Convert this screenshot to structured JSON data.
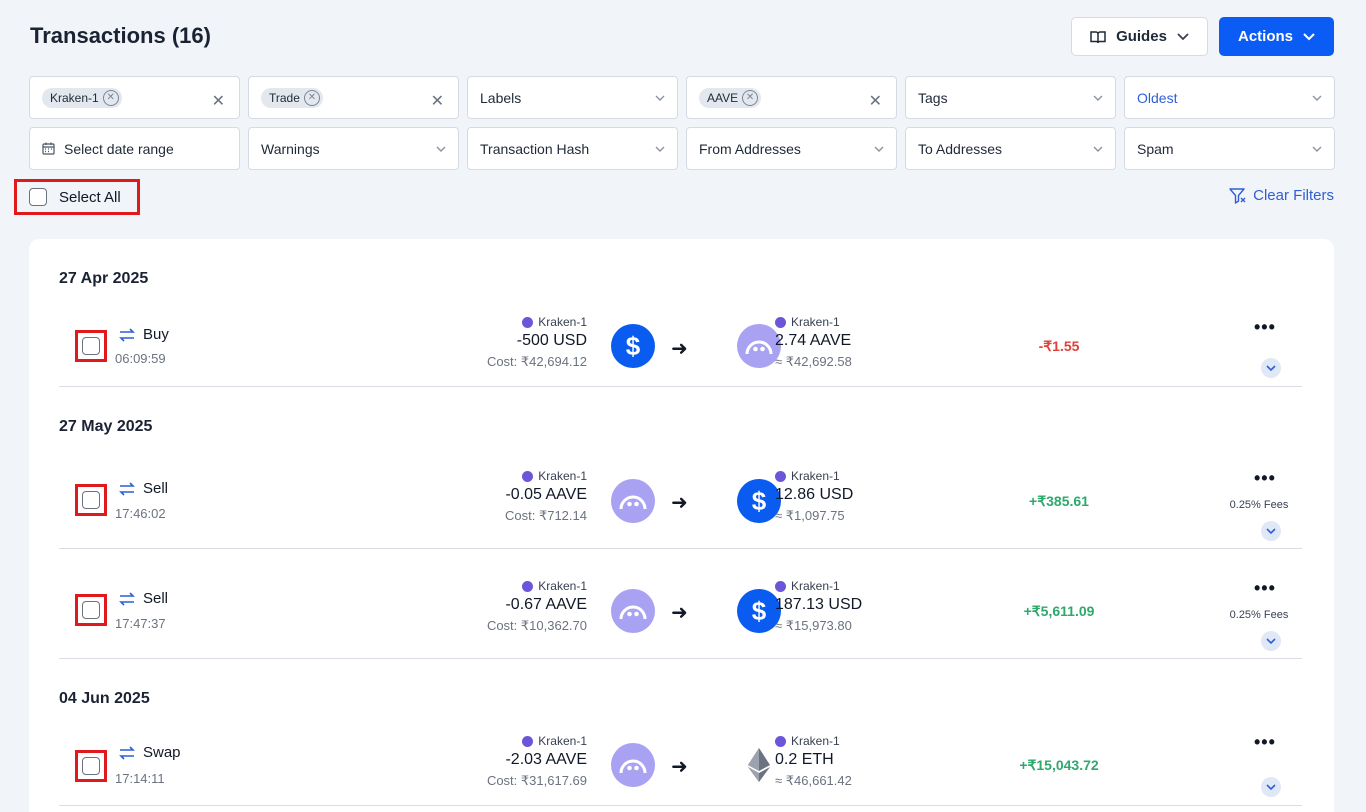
{
  "header": {
    "title": "Transactions (16)",
    "guides_label": "Guides",
    "actions_label": "Actions"
  },
  "filters": {
    "wallet_chip": "Kraken-1",
    "type_chip": "Trade",
    "labels": "Labels",
    "asset_chip": "AAVE",
    "tags": "Tags",
    "sort": "Oldest",
    "date_range": "Select date range",
    "warnings": "Warnings",
    "tx_hash": "Transaction Hash",
    "from_addresses": "From Addresses",
    "to_addresses": "To Addresses",
    "spam": "Spam"
  },
  "select_all_label": "Select All",
  "clear_filters_label": "Clear Filters",
  "groups": [
    {
      "date": "27 Apr 2025",
      "rows": [
        {
          "type": "Buy",
          "time": "06:09:59",
          "from_source": "Kraken-1",
          "from_amount": "-500 USD",
          "cost": "Cost: ₹42,694.12",
          "from_coin": "usd-coin",
          "to_source": "Kraken-1",
          "to_amount": "2.74 AAVE",
          "value": "≈ ₹42,692.58",
          "to_coin": "aave-coin",
          "gain": "-₹1.55",
          "fees": ""
        }
      ]
    },
    {
      "date": "27 May 2025",
      "rows": [
        {
          "type": "Sell",
          "time": "17:46:02",
          "from_source": "Kraken-1",
          "from_amount": "-0.05 AAVE",
          "cost": "Cost: ₹712.14",
          "from_coin": "aave-coin",
          "to_source": "Kraken-1",
          "to_amount": "12.86 USD",
          "value": "≈ ₹1,097.75",
          "to_coin": "usd-coin",
          "gain": "+₹385.61",
          "fees": "0.25% Fees"
        },
        {
          "type": "Sell",
          "time": "17:47:37",
          "from_source": "Kraken-1",
          "from_amount": "-0.67 AAVE",
          "cost": "Cost: ₹10,362.70",
          "from_coin": "aave-coin",
          "to_source": "Kraken-1",
          "to_amount": "187.13 USD",
          "value": "≈ ₹15,973.80",
          "to_coin": "usd-coin",
          "gain": "+₹5,611.09",
          "fees": "0.25% Fees"
        }
      ]
    },
    {
      "date": "04 Jun 2025",
      "rows": [
        {
          "type": "Swap",
          "time": "17:14:11",
          "from_source": "Kraken-1",
          "from_amount": "-2.03 AAVE",
          "cost": "Cost: ₹31,617.69",
          "from_coin": "aave-coin",
          "to_source": "Kraken-1",
          "to_amount": "0.2 ETH",
          "value": "≈ ₹46,661.42",
          "to_coin": "eth-coin",
          "gain": "+₹15,043.72",
          "fees": ""
        }
      ]
    }
  ],
  "colors": {
    "accent": "#0b5cf5",
    "highlight_border": "#e0191d",
    "gain_positive": "#2fa86c",
    "gain_negative": "#e0423a",
    "aave": "#a9a2f3"
  }
}
